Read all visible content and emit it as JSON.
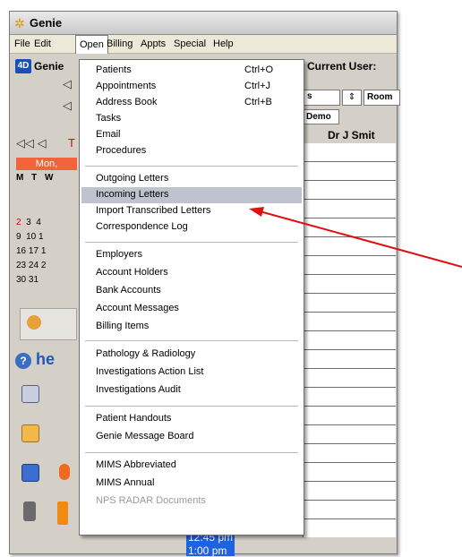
{
  "window": {
    "title": "Genie",
    "icon": "genie-app-icon"
  },
  "menubar": [
    "File",
    "Edit",
    "Open",
    "Billing",
    "Appts",
    "Special",
    "Help"
  ],
  "inner_window": {
    "title": "Genie",
    "current_user": "Current User:"
  },
  "toolbar": {
    "room_select_value": "s",
    "room_button": "Room",
    "demo_tab": "Demo"
  },
  "calendar": {
    "nav": "◁",
    "nav2": "◁",
    "nav3": "◁◁ ◁",
    "today_marker": "T",
    "day_button": "Mon,",
    "weekdays": "M T W",
    "rows": [
      {
        "a": "2",
        "b": "3",
        "c": "4"
      },
      {
        "a": "9",
        "b": "10",
        "c": "1"
      },
      {
        "a": "16",
        "b": "17",
        "c": "1"
      },
      {
        "a": "23",
        "b": "24",
        "c": "2"
      },
      {
        "a": "30",
        "b": "31",
        "c": ""
      }
    ]
  },
  "doctor_header": "Dr J Smit",
  "help_text": "he",
  "time_slots": {
    "slot1": "12:45 pm",
    "slot2": "1:00 pm"
  },
  "dropdown": {
    "group1": [
      {
        "label": "Patients",
        "shortcut": "Ctrl+O"
      },
      {
        "label": "Appointments",
        "shortcut": "Ctrl+J"
      },
      {
        "label": "Address Book",
        "shortcut": "Ctrl+B"
      },
      {
        "label": "Tasks",
        "shortcut": ""
      },
      {
        "label": "Email",
        "shortcut": ""
      },
      {
        "label": "Procedures",
        "shortcut": ""
      }
    ],
    "group2": [
      {
        "label": "Outgoing Letters"
      },
      {
        "label": "Incoming Letters"
      },
      {
        "label": "Import Transcribed Letters"
      },
      {
        "label": "Correspondence Log"
      }
    ],
    "group3": [
      {
        "label": "Employers"
      },
      {
        "label": "Account Holders"
      },
      {
        "label": "Bank Accounts"
      },
      {
        "label": "Account Messages"
      },
      {
        "label": "Billing Items"
      }
    ],
    "group4": [
      {
        "label": "Pathology & Radiology"
      },
      {
        "label": "Investigations Action List"
      },
      {
        "label": "Investigations Audit"
      }
    ],
    "group5": [
      {
        "label": "Patient Handouts"
      },
      {
        "label": "Genie Message Board"
      }
    ],
    "group6": [
      {
        "label": "MIMS Abbreviated"
      },
      {
        "label": "MIMS Annual"
      },
      {
        "label": "NPS RADAR Documents"
      }
    ]
  },
  "colors": {
    "highlight": "#bfc3d0",
    "annotation_arrow": "#e01010",
    "time_slot": "#1e62e0"
  }
}
